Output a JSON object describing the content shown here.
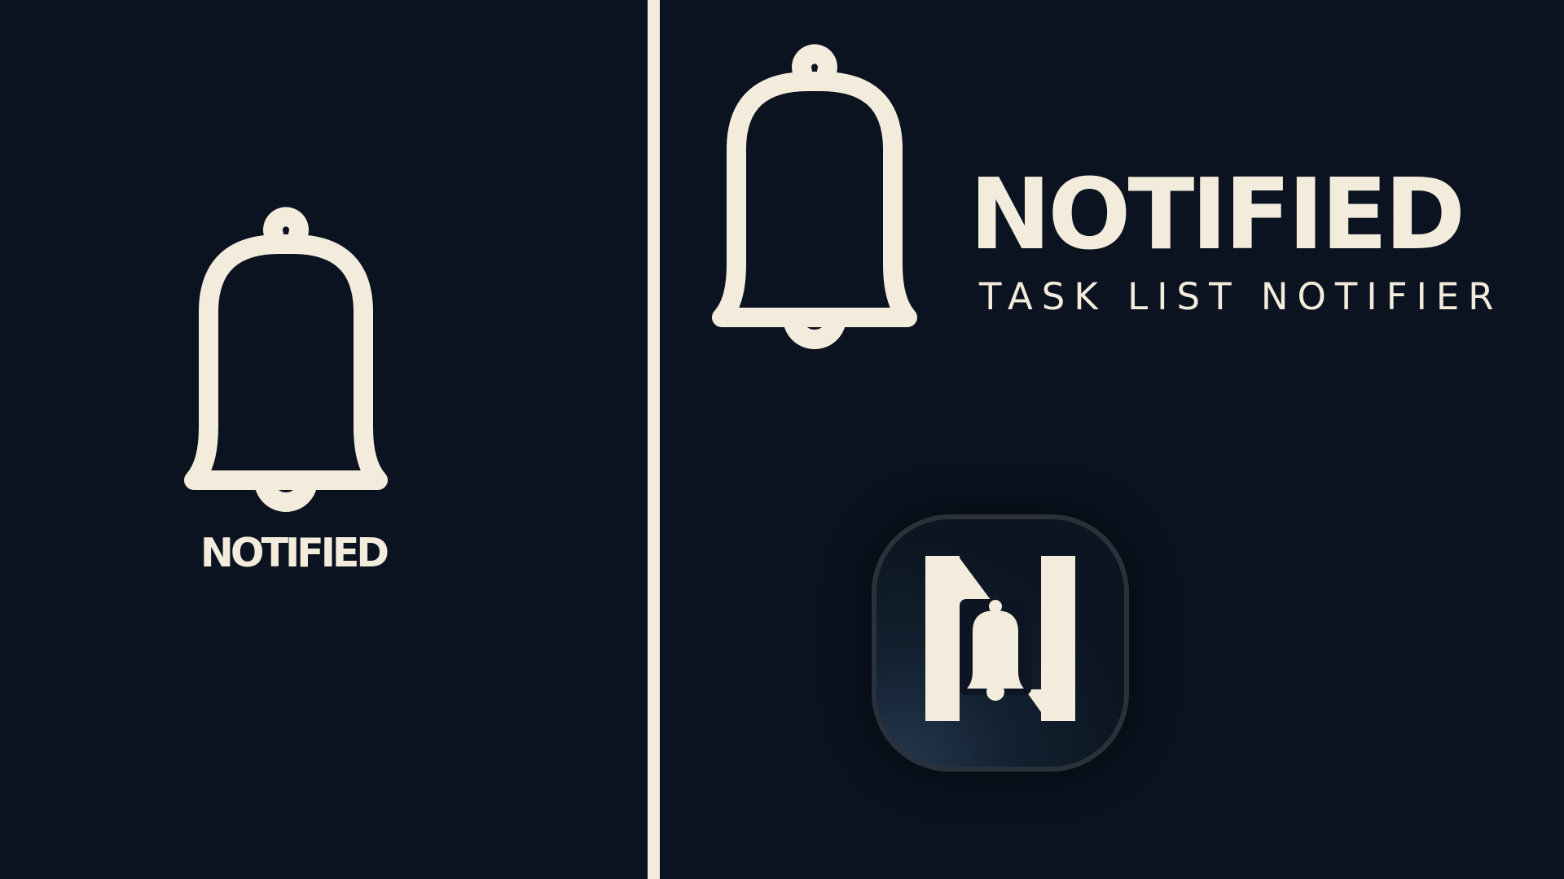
{
  "colors": {
    "background": "#0b1320",
    "brand_cream": "#f3ecdd",
    "icon_tile_border": "#2a313b"
  },
  "left_panel": {
    "icon": "bell-outline-icon",
    "wordmark": "NOTIFIED"
  },
  "right_panel": {
    "icon": "bell-outline-icon",
    "wordmark": "NOTIFIED",
    "tagline": "TASK LIST NOTIFIER",
    "app_icon": {
      "letter_icon": "letter-n-icon",
      "bell_icon": "bell-filled-icon"
    }
  }
}
